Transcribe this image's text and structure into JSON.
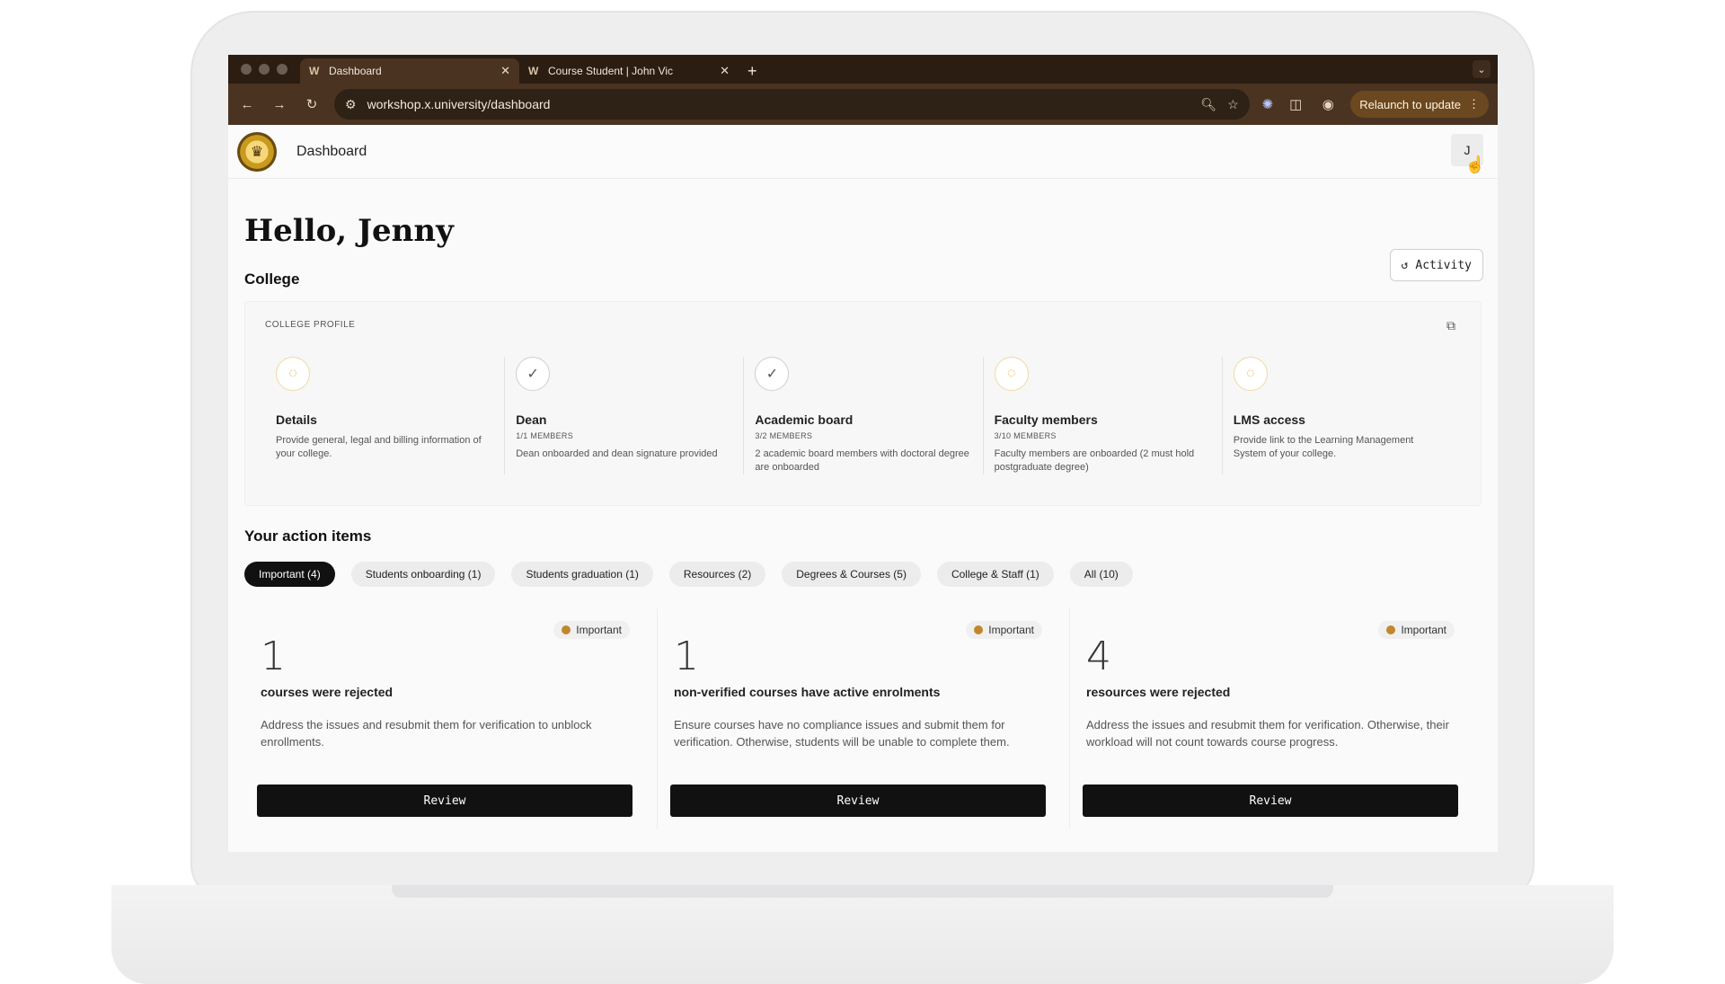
{
  "browser": {
    "tabs": [
      {
        "favicon": "W",
        "title": "Dashboard",
        "active": true
      },
      {
        "favicon": "W",
        "title": "Course Student | John Vic",
        "active": false
      }
    ],
    "new_tab": "+",
    "url": "workshop.x.university/dashboard",
    "relaunch_label": "Relaunch to update"
  },
  "app": {
    "title": "Dashboard",
    "avatar_initial": "J",
    "greeting": "Hello, Jenny",
    "activity_label": "Activity"
  },
  "college": {
    "section_title": "College",
    "panel_label": "COLLEGE PROFILE",
    "steps": [
      {
        "status": "pending",
        "title": "Details",
        "sub": "",
        "desc": "Provide general, legal and billing information of your college."
      },
      {
        "status": "done",
        "title": "Dean",
        "sub": "1/1 MEMBERS",
        "desc": "Dean onboarded and dean signature provided"
      },
      {
        "status": "done",
        "title": "Academic board",
        "sub": "3/2 MEMBERS",
        "desc": "2 academic board members with doctoral degree are onboarded"
      },
      {
        "status": "pending",
        "title": "Faculty members",
        "sub": "3/10 MEMBERS",
        "desc": "Faculty members are onboarded (2 must hold postgraduate degree)"
      },
      {
        "status": "pending",
        "title": "LMS access",
        "sub": "",
        "desc": "Provide link to the Learning Management System of your college."
      }
    ]
  },
  "actions": {
    "section_title": "Your action items",
    "filters": [
      {
        "label": "Important (4)",
        "active": true
      },
      {
        "label": "Students onboarding (1)",
        "active": false
      },
      {
        "label": "Students graduation (1)",
        "active": false
      },
      {
        "label": "Resources (2)",
        "active": false
      },
      {
        "label": "Degrees & Courses (5)",
        "active": false
      },
      {
        "label": "College & Staff (1)",
        "active": false
      },
      {
        "label": "All (10)",
        "active": false
      }
    ],
    "cards": [
      {
        "badge": "Important",
        "count": "1",
        "title": "courses were rejected",
        "desc": "Address the issues and resubmit them for verification to unblock enrollments.",
        "button": "Review"
      },
      {
        "badge": "Important",
        "count": "1",
        "title": "non-verified courses have active enrolments",
        "desc": "Ensure courses have no compliance issues and submit them for verification. Otherwise, students will be unable to complete them.",
        "button": "Review"
      },
      {
        "badge": "Important",
        "count": "4",
        "title": "resources were rejected",
        "desc": "Address the issues and resubmit them for verification. Otherwise, their workload will not count towards course progress.",
        "button": "Review"
      }
    ]
  },
  "colors": {
    "chrome_dark": "#2b1d12",
    "chrome_toolbar": "#4a3320",
    "accent_important": "#c1872a",
    "pending_icon": "#e0a92a"
  },
  "icons": {
    "back": "arrow-left-icon",
    "forward": "arrow-right-icon",
    "reload": "reload-icon",
    "site_settings": "tune-icon",
    "zoom": "search-icon",
    "bookmark": "star-icon",
    "extension": "puzzle-icon",
    "activity": "history-icon",
    "external": "external-link-icon",
    "pending": "spinner-icon",
    "done": "check-icon"
  }
}
